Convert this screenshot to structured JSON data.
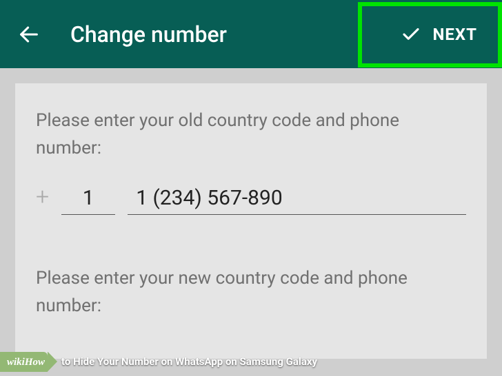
{
  "appbar": {
    "title": "Change number",
    "next_label": "NEXT"
  },
  "form": {
    "old_prompt": "Please enter your old country code and phone number:",
    "new_prompt": "Please enter your new country code and phone number:",
    "plus": "+",
    "old_country_code": "1",
    "old_phone": "1 (234) 567-890"
  },
  "banner": {
    "logo_wiki": "wiki",
    "logo_how": "How",
    "caption": " to Hide Your Number on WhatsApp on Samsung Galaxy"
  }
}
